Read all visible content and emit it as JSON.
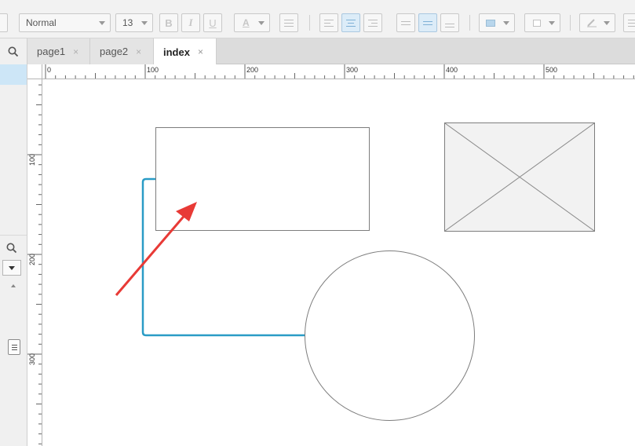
{
  "toolbar": {
    "font_style": "Normal",
    "font_size": "13",
    "bold_label": "B",
    "italic_label": "I",
    "underline_label": "U",
    "font_color_label": "A",
    "icons": [
      "bullet-list-icon",
      "align-left-icon",
      "align-center-icon",
      "align-right-icon",
      "valign-top-icon",
      "valign-middle-icon",
      "valign-bottom-icon",
      "fill-color-icon",
      "shadow-icon",
      "line-color-icon"
    ]
  },
  "tabs": [
    {
      "label": "page1",
      "close": "×",
      "active": false
    },
    {
      "label": "page2",
      "close": "×",
      "active": false
    },
    {
      "label": "index",
      "close": "×",
      "active": true
    }
  ],
  "ruler": {
    "top_labels": [
      "0",
      "100",
      "200",
      "300",
      "400",
      "500"
    ],
    "left_labels": [
      "100",
      "200",
      "300"
    ]
  },
  "colors": {
    "connector": "#2a9cc6",
    "arrow": "#e83a36",
    "shape_border": "#7d7d7d",
    "selection": "#cde6f7"
  },
  "canvas": {
    "shapes": [
      "rectangle",
      "image-placeholder",
      "circle"
    ]
  }
}
